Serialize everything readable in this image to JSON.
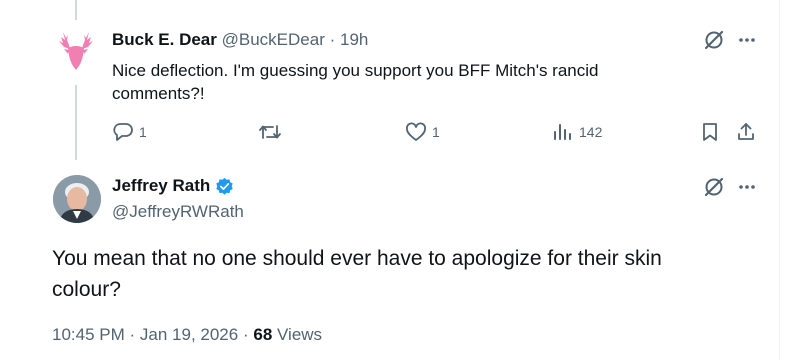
{
  "reply": {
    "display_name": "Buck E. Dear",
    "handle": "@BuckEDear",
    "separator": "·",
    "time": "19h",
    "text": "Nice deflection. I'm guessing you support you BFF Mitch's rancid comments?!",
    "reply_count": "1",
    "like_count": "1",
    "view_count": "142"
  },
  "main": {
    "display_name": "Jeffrey Rath",
    "handle": "@JeffreyRWRath",
    "text": "You mean that no one should ever have to apologize for their skin colour?",
    "time": "10:45 PM",
    "sep1": "·",
    "date": "Jan 19, 2026",
    "sep2": "·",
    "views": "68",
    "views_label": "Views"
  },
  "colors": {
    "text": "#0f1419",
    "muted": "#536471",
    "verified": "#1d9bf0",
    "deer": "#f27fb2"
  }
}
